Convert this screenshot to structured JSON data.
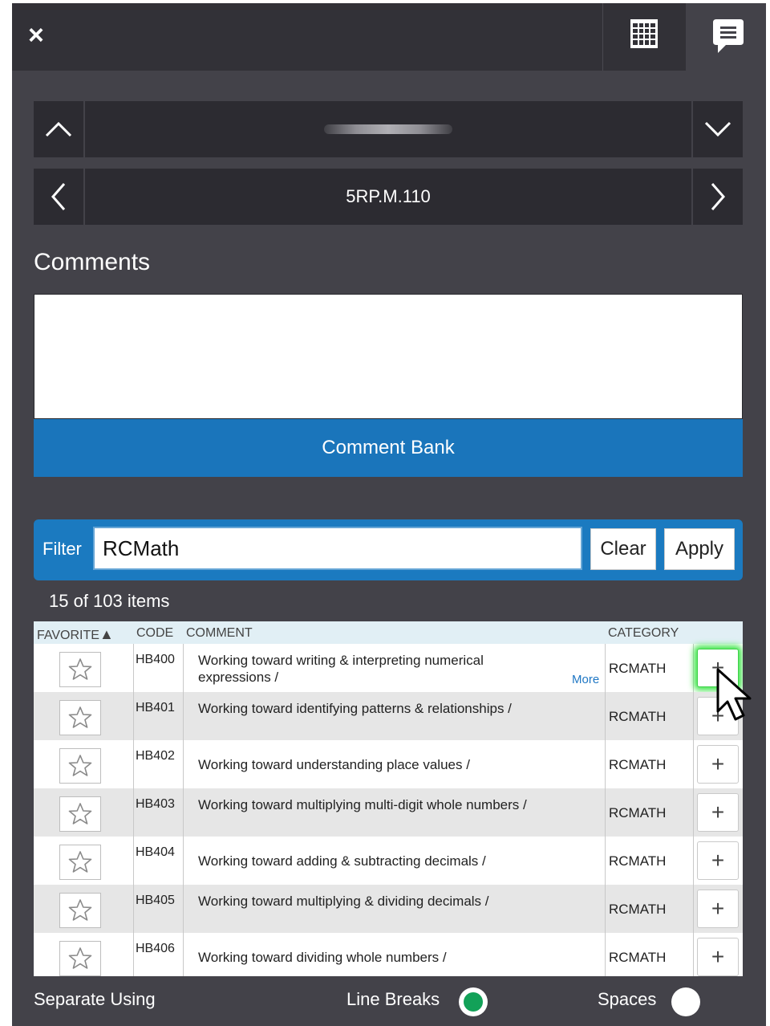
{
  "topbar": {
    "close_label": "×",
    "grid_icon": "grid-icon",
    "comment_icon": "comment-bubble-icon"
  },
  "student_nav": {
    "prev_icon": "chevron-up-icon",
    "next_icon": "chevron-down-icon",
    "label": ""
  },
  "section_nav": {
    "prev_icon": "chevron-left-icon",
    "next_icon": "chevron-right-icon",
    "label": "5RP.M.110"
  },
  "comments": {
    "title": "Comments",
    "value": "",
    "bank_button": "Comment Bank"
  },
  "filter": {
    "label": "Filter",
    "value": "RCMath",
    "clear_button": "Clear",
    "apply_button": "Apply"
  },
  "item_count": "15 of 103 items",
  "table": {
    "headers": {
      "favorite": "FAVORITE",
      "code": "CODE",
      "comment": "COMMENT",
      "category": "CATEGORY"
    },
    "sort_indicator": "▲",
    "more_label": "More",
    "rows": [
      {
        "code": "HB400",
        "comment": "Working toward writing & interpreting numerical expressions /",
        "category": "RCMATH"
      },
      {
        "code": "HB401",
        "comment": "Working toward identifying patterns & relationships /",
        "category": "RCMATH"
      },
      {
        "code": "HB402",
        "comment": "Working toward understanding place values /",
        "category": "RCMATH"
      },
      {
        "code": "HB403",
        "comment": "Working toward multiplying multi-digit whole numbers /",
        "category": "RCMATH"
      },
      {
        "code": "HB404",
        "comment": "Working toward adding & subtracting decimals /",
        "category": "RCMATH"
      },
      {
        "code": "HB405",
        "comment": "Working toward multiplying & dividing decimals /",
        "category": "RCMATH"
      },
      {
        "code": "HB406",
        "comment": "Working toward dividing whole numbers /",
        "category": "RCMATH"
      }
    ]
  },
  "separate": {
    "label": "Separate Using",
    "line_breaks_label": "Line Breaks",
    "spaces_label": "Spaces",
    "selected": "Line Breaks"
  },
  "colors": {
    "accent": "#1a75bb",
    "background": "#434249",
    "topbar": "#323137",
    "selected_radio": "#12a158"
  }
}
